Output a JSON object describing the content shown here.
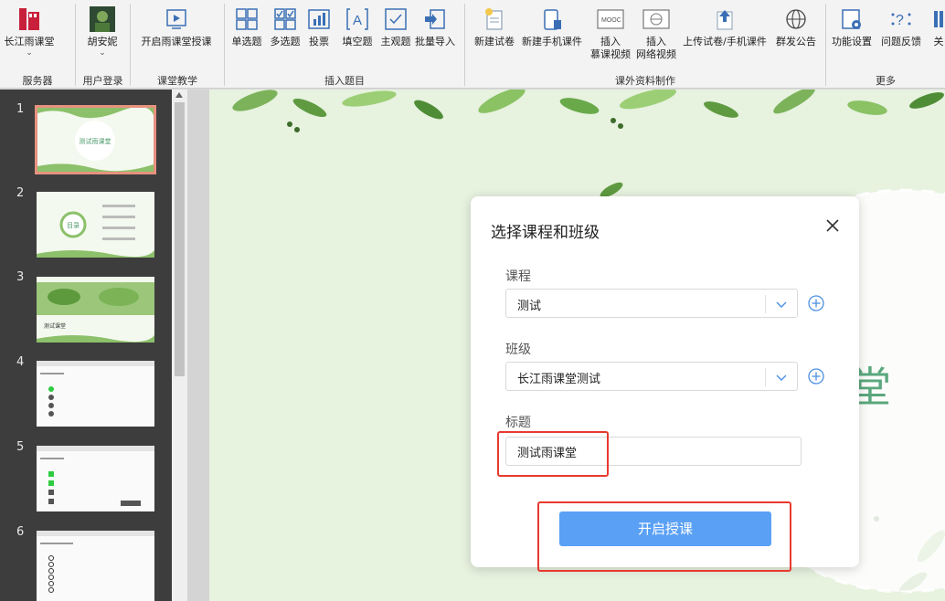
{
  "ribbon": {
    "buttons": [
      {
        "label": "长江雨课堂",
        "sub": "⌄",
        "icon": "app-logo-icon"
      },
      {
        "label": "胡安妮",
        "sub": "⌄",
        "icon": "user-avatar-icon"
      },
      {
        "label": "开启雨课堂授课",
        "icon": "start-class-icon"
      },
      {
        "label": "单选题",
        "icon": "single-choice-icon"
      },
      {
        "label": "多选题",
        "icon": "multi-choice-icon"
      },
      {
        "label": "投票",
        "icon": "vote-icon"
      },
      {
        "label": "填空题",
        "icon": "fill-blank-icon"
      },
      {
        "label": "主观题",
        "icon": "subjective-icon"
      },
      {
        "label": "批量导入",
        "icon": "batch-import-icon"
      },
      {
        "label": "新建试卷",
        "icon": "new-exam-icon"
      },
      {
        "label": "新建手机课件",
        "icon": "new-mobile-courseware-icon"
      },
      {
        "label": "插入",
        "sub2": "慕课视频",
        "icon": "mooc-video-icon"
      },
      {
        "label": "插入",
        "sub2": "网络视频",
        "icon": "web-video-icon"
      },
      {
        "label": "上传试卷/手机课件",
        "icon": "upload-icon"
      },
      {
        "label": "群发公告",
        "icon": "broadcast-icon"
      },
      {
        "label": "功能设置",
        "icon": "settings-icon"
      },
      {
        "label": "问题反馈",
        "icon": "feedback-icon"
      },
      {
        "label": "关",
        "icon": "about-icon"
      }
    ],
    "groups": {
      "server": "服务器",
      "login": "用户登录",
      "teaching": "课堂教学",
      "insert_q": "插入题目",
      "extra": "课外资料制作",
      "more": "更多"
    }
  },
  "slides": [
    {
      "num": "1",
      "text": "测试雨课堂"
    },
    {
      "num": "2",
      "text": "目录"
    },
    {
      "num": "3",
      "text": "测试课堂"
    },
    {
      "num": "4",
      "text": ""
    },
    {
      "num": "5",
      "text": ""
    },
    {
      "num": "6",
      "text": ""
    }
  ],
  "canvas": {
    "visible_char": "堂"
  },
  "dialog": {
    "title": "选择课程和班级",
    "course_label": "课程",
    "course_value": "测试",
    "class_label": "班级",
    "class_value": "长江雨课堂测试",
    "title_label": "标题",
    "title_value": "测试雨课堂",
    "start_button": "开启授课"
  },
  "colors": {
    "primary_button": "#5aa0f5",
    "highlight_box": "#e8392f",
    "selected_slide_border": "#e7917f"
  }
}
